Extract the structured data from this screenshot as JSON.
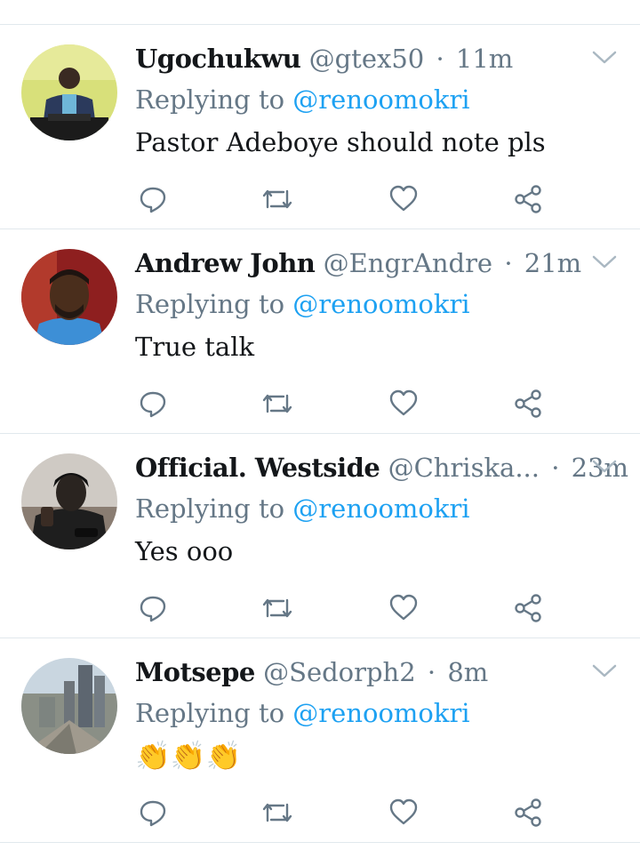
{
  "colors": {
    "link": "#1da1f2",
    "secondary_text": "#657786",
    "primary_text": "#14171a",
    "divider": "#e1e8ed"
  },
  "icons": [
    "reply-icon",
    "retweet-icon",
    "like-icon",
    "share-icon",
    "chevron-down-icon",
    "clapping-hands-emoji"
  ],
  "replies": [
    {
      "name": "Ugochukwu",
      "handle": "@gtex50",
      "separator": "·",
      "time": "11m",
      "replying_prefix": "Replying to",
      "replying_to": "@renoomokri",
      "text": "Pastor Adeboye should note pls"
    },
    {
      "name": "Andrew John",
      "handle": "@EngrAndre",
      "separator": "·",
      "time": "21m",
      "replying_prefix": "Replying to",
      "replying_to": "@renoomokri",
      "text": "True talk"
    },
    {
      "name": "Official. Westside",
      "handle": "@Chriska...",
      "separator": "·",
      "time": "23m",
      "replying_prefix": "Replying to",
      "replying_to": "@renoomokri",
      "text": "Yes ooo"
    },
    {
      "name": "Motsepe",
      "handle": "@Sedorph2",
      "separator": "·",
      "time": "8m",
      "replying_prefix": "Replying to",
      "replying_to": "@renoomokri",
      "text": "👏👏👏"
    }
  ]
}
